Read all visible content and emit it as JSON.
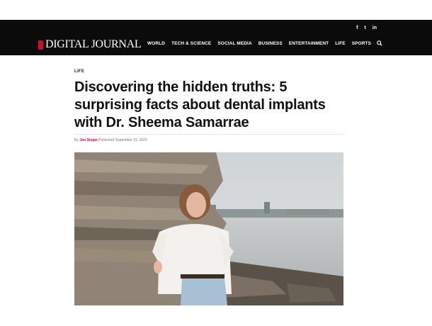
{
  "header": {
    "logo_text": "DIGITAL JOURNAL",
    "social": [
      "f",
      "t",
      "in"
    ],
    "nav": [
      "WORLD",
      "TECH & SCIENCE",
      "SOCIAL MEDIA",
      "BUSINESS",
      "ENTERTAINMENT",
      "LIFE",
      "SPORTS"
    ]
  },
  "article": {
    "category": "LIFE",
    "title": "Discovering the hidden truths: 5 surprising facts about dental implants with Dr. Sheema Samarrae",
    "by": "By",
    "author": "Jon Stojan",
    "published": "Published September 21, 2023"
  },
  "colors": {
    "accent": "#c8102e",
    "header_bg": "#0b0b0b"
  },
  "icons": [
    "facebook-icon",
    "twitter-icon",
    "linkedin-icon",
    "search-icon"
  ]
}
